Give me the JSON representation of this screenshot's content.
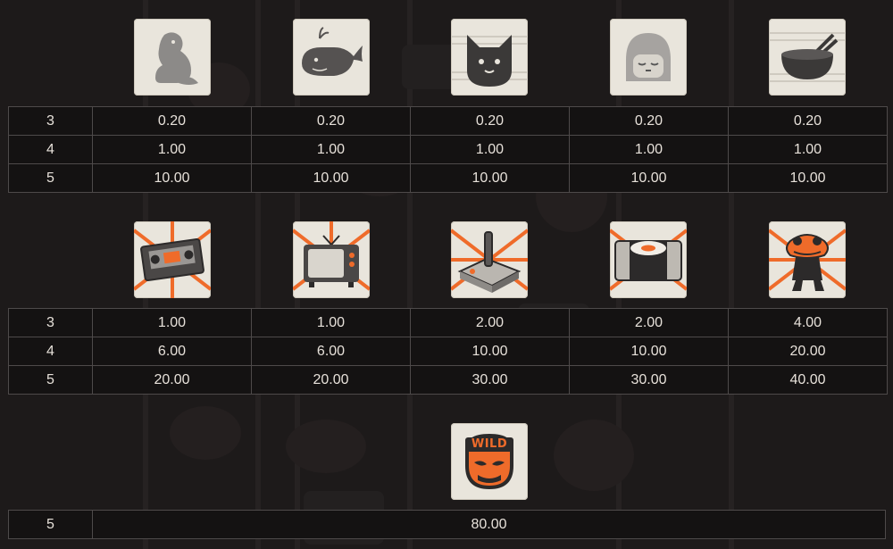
{
  "accent_color": "#ef6b2a",
  "tile_color": "#e9e5dc",
  "sections": [
    {
      "symbols": [
        {
          "name": "beaver",
          "icon": "beaver-icon"
        },
        {
          "name": "whale",
          "icon": "whale-icon"
        },
        {
          "name": "cat",
          "icon": "cat-icon"
        },
        {
          "name": "girl",
          "icon": "girl-icon"
        },
        {
          "name": "bowl",
          "icon": "bowl-chopsticks-icon"
        }
      ],
      "rows": [
        {
          "count": "3",
          "values": [
            "0.20",
            "0.20",
            "0.20",
            "0.20",
            "0.20"
          ]
        },
        {
          "count": "4",
          "values": [
            "1.00",
            "1.00",
            "1.00",
            "1.00",
            "1.00"
          ]
        },
        {
          "count": "5",
          "values": [
            "10.00",
            "10.00",
            "10.00",
            "10.00",
            "10.00"
          ]
        }
      ]
    },
    {
      "symbols": [
        {
          "name": "vhs",
          "icon": "vhs-tape-icon"
        },
        {
          "name": "tv",
          "icon": "tv-icon"
        },
        {
          "name": "joystick",
          "icon": "joystick-icon"
        },
        {
          "name": "sushi",
          "icon": "sushi-icon"
        },
        {
          "name": "frog",
          "icon": "frog-icon"
        }
      ],
      "rows": [
        {
          "count": "3",
          "values": [
            "1.00",
            "1.00",
            "2.00",
            "2.00",
            "4.00"
          ]
        },
        {
          "count": "4",
          "values": [
            "6.00",
            "6.00",
            "10.00",
            "10.00",
            "20.00"
          ]
        },
        {
          "count": "5",
          "values": [
            "20.00",
            "20.00",
            "30.00",
            "30.00",
            "40.00"
          ]
        }
      ]
    }
  ],
  "wild": {
    "label": "WILD",
    "icon": "wild-mask-icon",
    "count": "5",
    "value": "80.00"
  }
}
